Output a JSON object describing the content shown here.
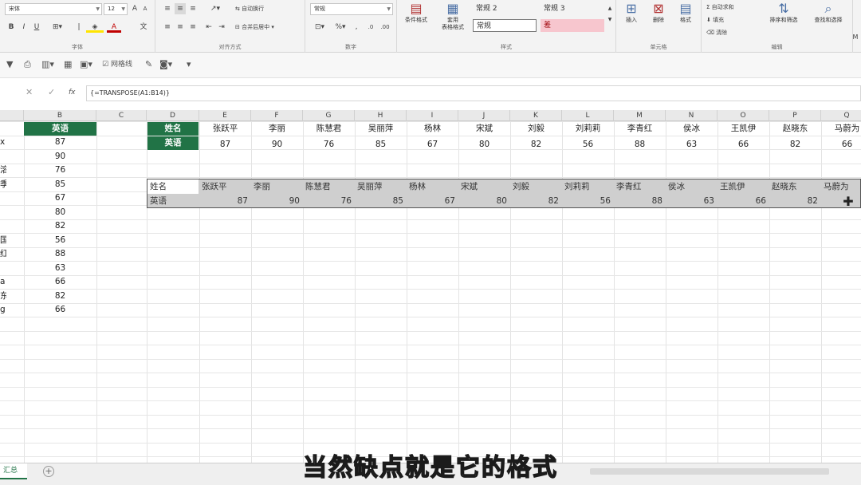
{
  "ribbon": {
    "font_name": "宋体",
    "font_size": "12",
    "font_group": "字体",
    "align_group": "对齐方式",
    "wrap_text": "自动换行",
    "merge_center": "合并后居中",
    "number_format": "常规",
    "number_group": "数字",
    "cond_format": "条件格式",
    "table_format": "套用\n表格格式",
    "style_group": "样式",
    "styles": [
      "常规 2",
      "常规 3",
      "常规",
      "差"
    ],
    "insert": "插入",
    "delete": "删除",
    "format": "格式",
    "cells_group": "单元格",
    "autosum": "自动求和",
    "fill": "填充",
    "clear": "清除",
    "edit_group": "编辑",
    "sort_filter": "排序和筛选",
    "find_select": "查找和选择",
    "overflow": "M",
    "colors": {
      "bad_fill": "#f7c6ce",
      "bad_text": "#9c0006",
      "green": "#217346"
    }
  },
  "quick_access": {
    "check_label": "网格线"
  },
  "formula_bar": {
    "formula": "{=TRANSPOSE(A1:B14)}",
    "cancel": "✕",
    "enter": "✓",
    "fx": "fx"
  },
  "columns": [
    "B",
    "C",
    "D",
    "E",
    "F",
    "G",
    "H",
    "I",
    "J",
    "K",
    "L",
    "M",
    "N",
    "O",
    "P",
    "Q"
  ],
  "col_b": {
    "header": "英语",
    "values": [
      "87",
      "90",
      "76",
      "85",
      "67",
      "80",
      "82",
      "56",
      "88",
      "63",
      "66",
      "82",
      "66"
    ],
    "a_clips": [
      "x",
      "",
      "溶",
      "季",
      "",
      "",
      "",
      "国",
      "红",
      "",
      "a",
      "东",
      "g"
    ]
  },
  "top_table": {
    "name_label": "姓名",
    "score_label": "英语",
    "names": [
      "张跃平",
      "李丽",
      "陈慧君",
      "吴丽萍",
      "杨林",
      "宋斌",
      "刘毅",
      "刘莉莉",
      "李青红",
      "侯冰",
      "王凯伊",
      "赵晓东",
      "马蔚为"
    ],
    "scores": [
      "87",
      "90",
      "76",
      "85",
      "67",
      "80",
      "82",
      "56",
      "88",
      "63",
      "66",
      "82",
      "66"
    ]
  },
  "paste_table": {
    "name_label": "姓名",
    "score_label": "英语",
    "names": [
      "张跃平",
      "李丽",
      "陈慧君",
      "吴丽萍",
      "杨林",
      "宋斌",
      "刘毅",
      "刘莉莉",
      "李青红",
      "侯冰",
      "王凯伊",
      "赵晓东",
      "马蔚为"
    ],
    "scores": [
      "87",
      "90",
      "76",
      "85",
      "67",
      "80",
      "82",
      "56",
      "88",
      "63",
      "66",
      "82"
    ]
  },
  "sheet_tab": "汇总",
  "subtitle": "当然缺点就是它的格式"
}
